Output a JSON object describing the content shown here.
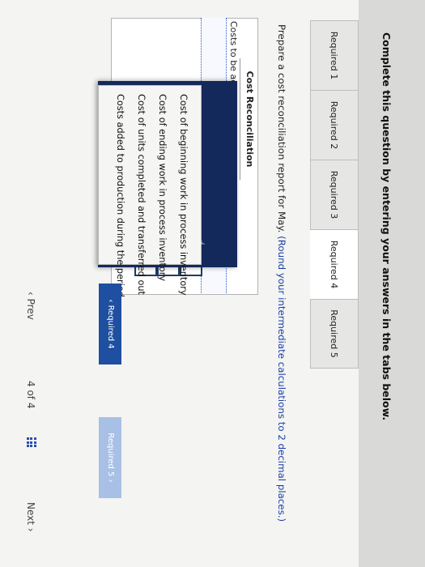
{
  "instruction": "Complete this question by entering your answers in the tabs below.",
  "tabs": [
    {
      "label": "Required 1"
    },
    {
      "label": "Required 2"
    },
    {
      "label": "Required 3"
    },
    {
      "label": "Required 4"
    },
    {
      "label": "Required 5"
    }
  ],
  "prompt": {
    "lead": "Prepare a cost reconciliation report for May.",
    "note": "(Round your intermediate calculations to 2 decimal places.)"
  },
  "report": {
    "title": "Cost Reconciliation",
    "section_label": "Costs to be accounted for:"
  },
  "dropdown": {
    "options": [
      "Cost of beginning work in process inventory",
      "Cost of ending work in process inventory",
      "Cost of units completed and transferred out",
      "Costs added to production during the period"
    ]
  },
  "buttons": {
    "prev_required": "Required 4",
    "next_required": "Required 5"
  },
  "pager": {
    "prev": "Prev",
    "position": "4 of 4",
    "next": "Next"
  },
  "icons": {
    "prev": "chevron-left-icon",
    "next": "chevron-right-icon",
    "grid": "grid-icon",
    "cursor": "hand-cursor-icon"
  }
}
